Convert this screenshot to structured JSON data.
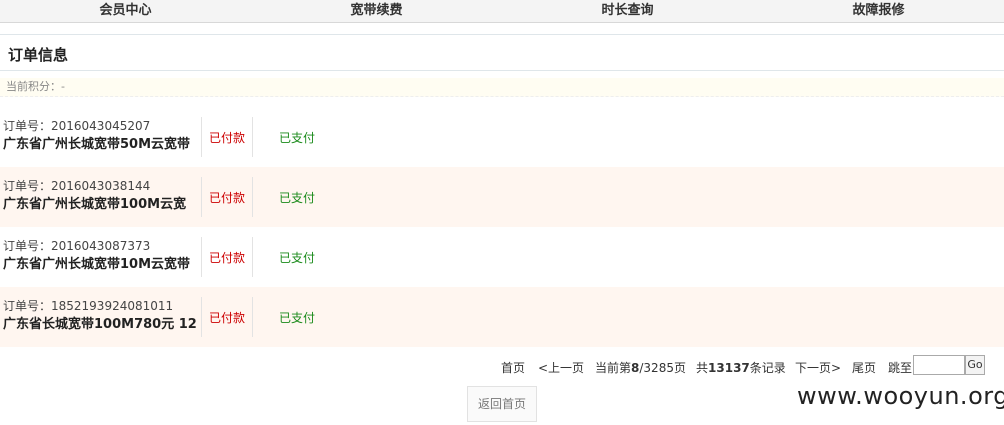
{
  "topnav": {
    "items": [
      "会员中心",
      "宽带续费",
      "时长查询",
      "故障报修"
    ]
  },
  "section": {
    "title": "订单信息"
  },
  "points": {
    "label": "当前积分：-"
  },
  "orders": [
    {
      "order_no": "订单号：2016043045207",
      "product": "广东省广州长城宽带50M云宽带",
      "payment": "已付款",
      "status": "已支付"
    },
    {
      "order_no": "订单号：2016043038144",
      "product": "广东省广州长城宽带100M云宽",
      "payment": "已付款",
      "status": "已支付"
    },
    {
      "order_no": "订单号：2016043087373",
      "product": "广东省广州长城宽带10M云宽带",
      "payment": "已付款",
      "status": "已支付"
    },
    {
      "order_no": "订单号：1852193924081011",
      "product": "广东省长城宽带100M780元 12",
      "payment": "已付款",
      "status": "已支付"
    }
  ],
  "pager": {
    "first": "首页",
    "prev": "<上一页",
    "current_prefix": "当前第",
    "current_page": "8",
    "total_pages": "/3285页",
    "total_prefix": "共",
    "total_records": "13137",
    "total_suffix": "条记录",
    "next": "下一页>",
    "last": "尾页",
    "jump_label": "跳至",
    "jump_value": "",
    "go": "Go"
  },
  "back_button": "返回首页",
  "watermark": "www.wooyun.org",
  "colors": {
    "paid": "#cc0000",
    "status": "#1a8a1a",
    "alt_row": "#fff6f0"
  }
}
